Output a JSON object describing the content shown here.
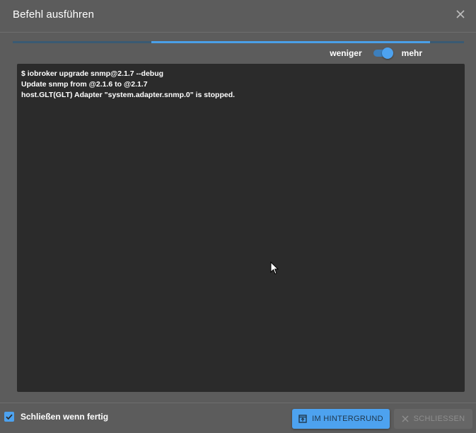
{
  "dialog": {
    "title": "Befehl ausführen",
    "close_icon": "close-icon"
  },
  "progress": {
    "start_fraction": 0.307,
    "end_fraction": 0.925
  },
  "toggle": {
    "left_label": "weniger",
    "right_label": "mehr",
    "state": "mehr"
  },
  "console": {
    "lines": [
      "$ iobroker upgrade snmp@2.1.7 --debug",
      "Update snmp from @2.1.6 to @2.1.7",
      "host.GLT(GLT) Adapter \"system.adapter.snmp.0\" is stopped."
    ]
  },
  "footer": {
    "checkbox_label": "Schließen wenn fertig",
    "checkbox_checked": true,
    "background_button": "IM HINTERGRUND",
    "background_icon": "open-in-new-icon",
    "close_button": "SCHLIESSEN",
    "close_button_icon": "close-icon"
  },
  "colors": {
    "accent": "#4da2ef",
    "dialog_bg": "#5c5c5c",
    "console_bg": "#2b2b2b"
  }
}
